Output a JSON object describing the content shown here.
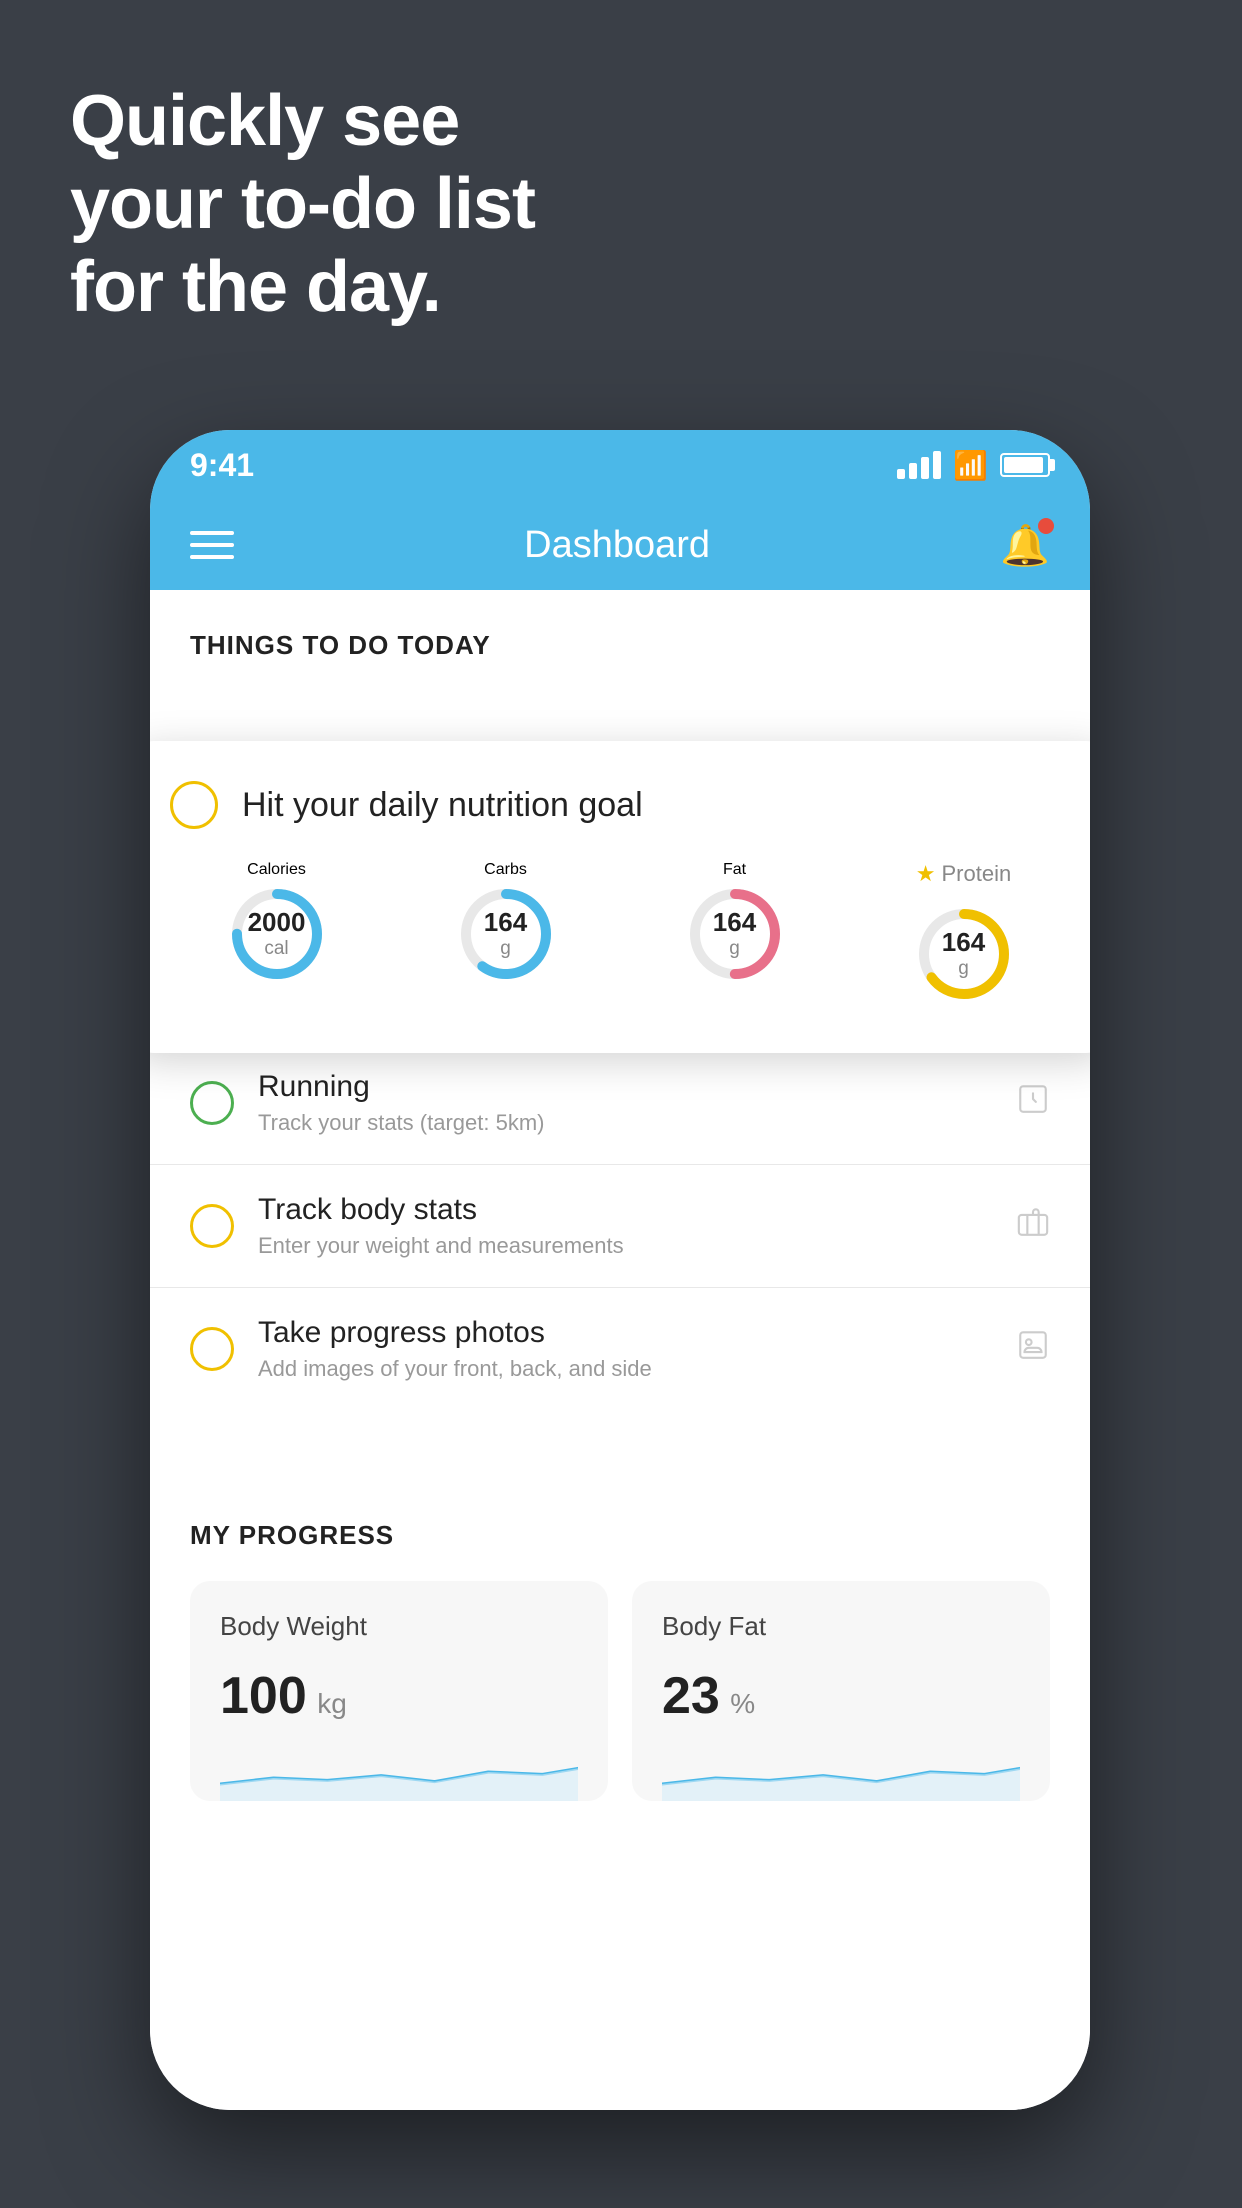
{
  "hero": {
    "line1": "Quickly see",
    "line2": "your to-do list",
    "line3": "for the day."
  },
  "status_bar": {
    "time": "9:41"
  },
  "header": {
    "title": "Dashboard"
  },
  "things_section": {
    "label": "THINGS TO DO TODAY"
  },
  "nutrition_card": {
    "title": "Hit your daily nutrition goal",
    "items": [
      {
        "label": "Calories",
        "value": "2000",
        "unit": "cal",
        "color": "#4bb8e8",
        "track": 75
      },
      {
        "label": "Carbs",
        "value": "164",
        "unit": "g",
        "color": "#4bb8e8",
        "track": 60
      },
      {
        "label": "Fat",
        "value": "164",
        "unit": "g",
        "color": "#e8708a",
        "track": 50
      },
      {
        "label": "Protein",
        "value": "164",
        "unit": "g",
        "color": "#f0c000",
        "track": 65,
        "star": true
      }
    ]
  },
  "todo_items": [
    {
      "title": "Running",
      "subtitle": "Track your stats (target: 5km)",
      "circle_color": "green",
      "icon": "👟"
    },
    {
      "title": "Track body stats",
      "subtitle": "Enter your weight and measurements",
      "circle_color": "yellow",
      "icon": "⚖️"
    },
    {
      "title": "Take progress photos",
      "subtitle": "Add images of your front, back, and side",
      "circle_color": "yellow",
      "icon": "👤"
    }
  ],
  "progress": {
    "section_title": "MY PROGRESS",
    "cards": [
      {
        "title": "Body Weight",
        "value": "100",
        "unit": "kg"
      },
      {
        "title": "Body Fat",
        "value": "23",
        "unit": "%"
      }
    ]
  }
}
